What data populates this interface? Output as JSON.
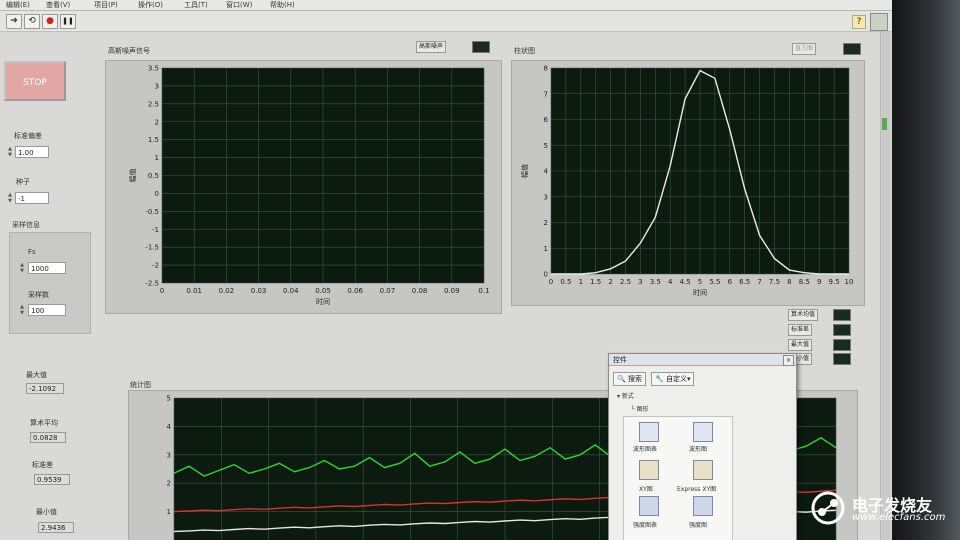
{
  "menu": [
    "编辑(E)",
    "查看(V)",
    "项目(P)",
    "操作(O)",
    "工具(T)",
    "窗口(W)",
    "帮助(H)"
  ],
  "toolbar": {
    "run_glyph": "➔",
    "run_cont_glyph": "⟲",
    "abort_glyph": "●",
    "pause_glyph": "❚❚",
    "help_glyph": "?"
  },
  "stop_label": "STOP",
  "controls": {
    "std_dev_label": "标准偏差",
    "std_dev_value": "1.00",
    "seed_label": "种子",
    "seed_value": "-1",
    "sampling_label": "采样信息",
    "fs_label": "Fs",
    "fs_value": "1000",
    "samples_label": "采样数",
    "samples_value": "100"
  },
  "indicators": {
    "max_label": "最大值",
    "max_value": "-2.1092",
    "mean_label": "算术平均",
    "mean_value": "0.0828",
    "std_label": "标准差",
    "std_value": "0.9539",
    "min_label": "最小值",
    "min_value": "2.9436"
  },
  "chart_data": [
    {
      "type": "line",
      "title": "高斯噪声信号",
      "legend": [
        "高斯噪声"
      ],
      "xlabel": "时间",
      "ylabel": "幅值",
      "xlim": [
        0,
        0.1
      ],
      "ylim": [
        -2.5,
        3.5
      ],
      "x_ticks": [
        "0",
        "0.01",
        "0.02",
        "0.03",
        "0.04",
        "0.05",
        "0.06",
        "0.07",
        "0.08",
        "0.09",
        "0.1"
      ],
      "y_ticks": [
        "3.5",
        "3",
        "2.5",
        "2",
        "1.5",
        "1",
        "0.5",
        "0",
        "-0.5",
        "-1",
        "-1.5",
        "-2",
        "-2.5"
      ],
      "grid": true,
      "series": []
    },
    {
      "type": "line",
      "title": "柱状图",
      "legend": [
        "直方图"
      ],
      "xlabel": "时间",
      "ylabel": "幅值",
      "xlim": [
        0,
        10
      ],
      "ylim": [
        0,
        8
      ],
      "x_ticks": [
        "0",
        "0.5",
        "1",
        "1.5",
        "2",
        "2.5",
        "3",
        "3.5",
        "4",
        "4.5",
        "5",
        "5.5",
        "6",
        "6.5",
        "7",
        "7.5",
        "8",
        "8.5",
        "9",
        "9.5",
        "10"
      ],
      "y_ticks": [
        "8",
        "7",
        "6",
        "5",
        "4",
        "3",
        "2",
        "1",
        "0"
      ],
      "grid": true,
      "series": [
        {
          "color": "#e8ece6",
          "x": [
            0,
            1,
            1.5,
            2,
            2.5,
            3,
            3.5,
            4,
            4.5,
            5,
            5.5,
            6,
            6.5,
            7,
            7.5,
            8,
            8.5,
            9,
            9.5,
            10
          ],
          "y": [
            0,
            0,
            0.05,
            0.2,
            0.5,
            1.2,
            2.2,
            4.2,
            6.8,
            7.9,
            7.6,
            5.6,
            3.3,
            1.5,
            0.6,
            0.15,
            0.05,
            0,
            0,
            0
          ]
        }
      ]
    },
    {
      "type": "line",
      "title": "统计图",
      "legend": [
        "算术均值",
        "标准差",
        "最大值",
        "最小值"
      ],
      "ylim": [
        0,
        5
      ],
      "y_ticks": [
        "5",
        "4",
        "3",
        "2",
        "1"
      ],
      "grid": true,
      "series": [
        {
          "color": "#2ed62e",
          "values": [
            2.35,
            2.6,
            2.25,
            2.45,
            2.65,
            2.35,
            2.5,
            2.7,
            2.4,
            2.55,
            2.8,
            2.5,
            2.6,
            2.9,
            2.55,
            2.7,
            3.05,
            2.6,
            2.75,
            3.1,
            2.7,
            2.85,
            3.2,
            2.8,
            2.95,
            3.25,
            2.85,
            3.0,
            3.35,
            2.95,
            3.1,
            3.4,
            3.0,
            3.15,
            3.3,
            3.05,
            3.2,
            3.45,
            3.1,
            3.3,
            3.5,
            3.15,
            3.3,
            3.6,
            3.25
          ]
        },
        {
          "color": "#e03030",
          "values": [
            1.0,
            1.02,
            1.05,
            1.03,
            1.07,
            1.1,
            1.08,
            1.12,
            1.15,
            1.13,
            1.17,
            1.2,
            1.18,
            1.22,
            1.25,
            1.23,
            1.27,
            1.3,
            1.28,
            1.32,
            1.35,
            1.33,
            1.37,
            1.4,
            1.38,
            1.42,
            1.45,
            1.43,
            1.47,
            1.5,
            1.48,
            1.52,
            1.55,
            1.53,
            1.57,
            1.6,
            1.58,
            1.62,
            1.65,
            1.63,
            1.67,
            1.7,
            1.68,
            1.72,
            1.75
          ]
        },
        {
          "color": "#e6e6e6",
          "values": [
            0.3,
            0.32,
            0.35,
            0.33,
            0.37,
            0.4,
            0.38,
            0.42,
            0.45,
            0.43,
            0.47,
            0.5,
            0.48,
            0.52,
            0.55,
            0.53,
            0.57,
            0.6,
            0.58,
            0.62,
            0.65,
            0.63,
            0.67,
            0.7,
            0.68,
            0.72,
            0.75,
            0.73,
            0.77,
            0.8,
            0.78,
            0.82,
            0.85,
            0.83,
            0.87,
            0.9,
            0.88,
            0.92,
            0.95,
            0.93,
            0.97,
            1.0,
            0.98,
            1.02,
            1.05
          ]
        }
      ]
    }
  ],
  "palette": {
    "title": "控件",
    "search_label": "搜索",
    "custom_label": "自定义",
    "tree_root": "新式",
    "tree_child": "图形",
    "items": [
      "波形图表",
      "波形图",
      "XY图",
      "Express XY图",
      "强度图表",
      "强度图"
    ]
  },
  "watermark": {
    "cn": "电子发烧友",
    "url": "www.elecfans.com"
  }
}
